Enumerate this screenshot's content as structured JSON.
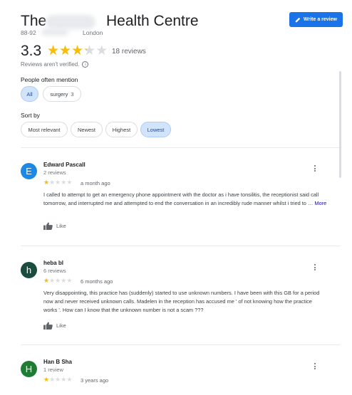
{
  "header": {
    "title_left": "The",
    "title_right": "Health Centre",
    "address_number": "88-92",
    "address_city": "London",
    "write_review_label": "Write a review",
    "write_review_icon": "pencil-icon",
    "accent_color": "#1a73e8"
  },
  "summary": {
    "rating": "3.3",
    "rating_value": 3.3,
    "review_count": "18 reviews",
    "unverified_note": "Reviews aren't verified."
  },
  "mentions": {
    "label": "People often mention",
    "chips": [
      {
        "label": "All",
        "count": "",
        "selected": true
      },
      {
        "label": "surgery",
        "count": "3",
        "selected": false
      }
    ]
  },
  "sort": {
    "label": "Sort by",
    "options": [
      {
        "label": "Most relevant",
        "selected": false
      },
      {
        "label": "Newest",
        "selected": false
      },
      {
        "label": "Highest",
        "selected": false
      },
      {
        "label": "Lowest",
        "selected": true
      }
    ]
  },
  "reviews": [
    {
      "initial": "E",
      "avatar_color": "#1e88e5",
      "name": "Edward Pascall",
      "meta": "2 reviews",
      "stars": 1,
      "when": "a month ago",
      "text": "I called to attempt to get an emergency phone appointment with the doctor as i have tonsilitis, the receptionist said call tomorrow, and interrupted me and attempted to end the conversation in an incredibly rude manner whilst i tried to …",
      "more_label": "More",
      "like_label": "Like"
    },
    {
      "initial": "h",
      "avatar_color": "#1b4d3e",
      "name": "heba bl",
      "meta": "6 reviews",
      "stars": 1,
      "when": "6 months ago",
      "text": "Very disappointing, this practice has (suddenly) started to use unknown numbers. I have been with this GB for a period now and never received unknown calls. Madelen in the reception has accused me ' of not knowing how the practice works '. How can I know that the unknown number is not a scam ???",
      "more_label": "",
      "like_label": "Like"
    },
    {
      "initial": "H",
      "avatar_color": "#1e7d32",
      "name": "Han B Sha",
      "meta": "1 review",
      "stars": 1,
      "when": "3 years ago",
      "text": "",
      "more_label": "",
      "like_label": ""
    }
  ]
}
